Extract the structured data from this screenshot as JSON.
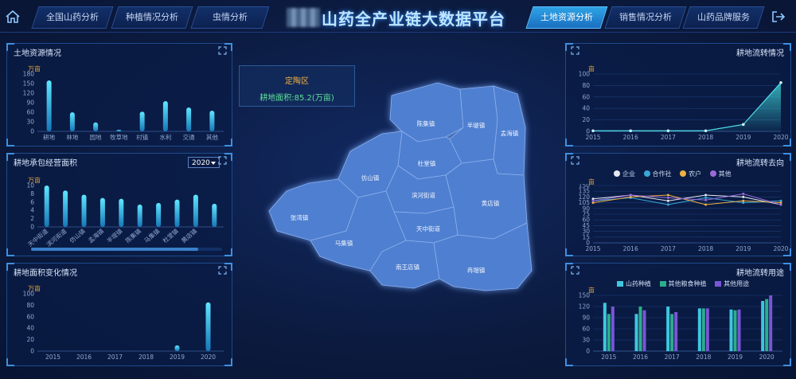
{
  "header": {
    "title": "山药全产业链大数据平台",
    "left_tabs": [
      "全国山药分析",
      "种植情况分析",
      "虫情分析"
    ],
    "right_tabs": [
      "土地资源分析",
      "销售情况分析",
      "山药品牌服务"
    ],
    "active_tab": "土地资源分析"
  },
  "info_box": {
    "name": "定陶区",
    "value": "耕地面积:85.2(万亩)"
  },
  "map": {
    "towns": [
      "陈集镇",
      "半堤镇",
      "孟海镇",
      "杜堂镇",
      "仿山镇",
      "滨河街道",
      "黄店镇",
      "张湾镇",
      "天中街道",
      "马集镇",
      "南王店镇",
      "冉堌镇"
    ]
  },
  "panels": {
    "land": {
      "title": "土地资源情况",
      "unit": "万亩"
    },
    "contract": {
      "title": "耕地承包经营面积",
      "unit": "万亩",
      "year": "2020"
    },
    "change": {
      "title": "耕地面积变化情况",
      "unit": "万亩"
    },
    "transfer": {
      "title": "耕地流转情况",
      "unit": "亩"
    },
    "direction": {
      "title": "耕地流转去向",
      "unit": "亩",
      "legend": [
        "企业",
        "合作社",
        "农户",
        "其他"
      ]
    },
    "usage": {
      "title": "耕地流转用途",
      "unit": "亩",
      "legend": [
        "山药种植",
        "其他粮食种植",
        "其他用途"
      ]
    }
  },
  "chart_data": [
    {
      "type": "bar",
      "title": "土地资源情况",
      "ylabel": "万亩",
      "ylim": [
        0,
        180
      ],
      "yticks": [
        "0",
        "30",
        "60",
        "90",
        "120",
        "150",
        "180"
      ],
      "categories": [
        "耕地",
        "林地",
        "园地",
        "牧草地",
        "村镇",
        "水利",
        "交通",
        "其他"
      ],
      "values": [
        160,
        60,
        28,
        5,
        62,
        95,
        75,
        65
      ]
    },
    {
      "type": "bar",
      "title": "耕地承包经营面积",
      "ylabel": "万亩",
      "ylim": [
        0,
        10
      ],
      "yticks": [
        "0",
        "2",
        "4",
        "6",
        "8",
        "10"
      ],
      "categories": [
        "天中街道",
        "滨河街道",
        "仿山镇",
        "孟海镇",
        "半堤镇",
        "陈集镇",
        "马集镇",
        "杜堂镇",
        "黄店镇"
      ],
      "values": [
        10,
        8.8,
        7.8,
        7,
        6.8,
        5.4,
        5.8,
        6.6,
        7.8,
        5.6
      ]
    },
    {
      "type": "bar",
      "title": "耕地面积变化情况",
      "ylabel": "万亩",
      "ylim": [
        0,
        100
      ],
      "yticks": [
        "0",
        "20",
        "40",
        "60",
        "80",
        "100"
      ],
      "categories": [
        "2015",
        "2016",
        "2017",
        "2018",
        "2019",
        "2020"
      ],
      "values": [
        0,
        0,
        0,
        0,
        10,
        85
      ]
    },
    {
      "type": "area",
      "title": "耕地流转情况",
      "ylabel": "亩",
      "ylim": [
        0,
        100
      ],
      "yticks": [
        "0",
        "20",
        "40",
        "60",
        "80",
        "100"
      ],
      "categories": [
        "2015",
        "2016",
        "2017",
        "2018",
        "2019",
        "2020"
      ],
      "values": [
        1,
        1,
        1,
        1,
        12,
        85
      ]
    },
    {
      "type": "line",
      "title": "耕地流转去向",
      "ylabel": "亩",
      "ylim": [
        0,
        150
      ],
      "yticks": [
        "0",
        "15",
        "30",
        "45",
        "60",
        "75",
        "90",
        "105",
        "120",
        "135",
        "150"
      ],
      "categories": [
        "2015",
        "2016",
        "2017",
        "2018",
        "2019",
        "2020"
      ],
      "series": [
        {
          "name": "企业",
          "values": [
            115,
            125,
            110,
            125,
            120,
            100
          ],
          "color": "#e8e8f0"
        },
        {
          "name": "合作社",
          "values": [
            110,
            118,
            100,
            118,
            105,
            110
          ],
          "color": "#3aa7d8"
        },
        {
          "name": "农户",
          "values": [
            105,
            120,
            125,
            100,
            110,
            105
          ],
          "color": "#f0b040"
        },
        {
          "name": "其他",
          "values": [
            110,
            125,
            118,
            112,
            128,
            100
          ],
          "color": "#9a6ad8"
        }
      ]
    },
    {
      "type": "bar",
      "title": "耕地流转用途",
      "ylabel": "亩",
      "ylim": [
        0,
        150
      ],
      "yticks": [
        "0",
        "30",
        "60",
        "90",
        "120",
        "150"
      ],
      "categories": [
        "2015",
        "2016",
        "2017",
        "2018",
        "2019",
        "2020"
      ],
      "series": [
        {
          "name": "山药种植",
          "values": [
            130,
            100,
            120,
            115,
            112,
            135
          ],
          "color": "#3fc6e0"
        },
        {
          "name": "其他粮食种植",
          "values": [
            100,
            120,
            100,
            115,
            110,
            140
          ],
          "color": "#2cae8c"
        },
        {
          "name": "其他用途",
          "values": [
            120,
            110,
            105,
            115,
            112,
            150
          ],
          "color": "#7a55d6"
        }
      ]
    }
  ],
  "colors": {
    "accent": "#2fa3e6",
    "bar": "#3fc6e0",
    "unit": "#e0a23c",
    "map": "#4f7fd0"
  }
}
